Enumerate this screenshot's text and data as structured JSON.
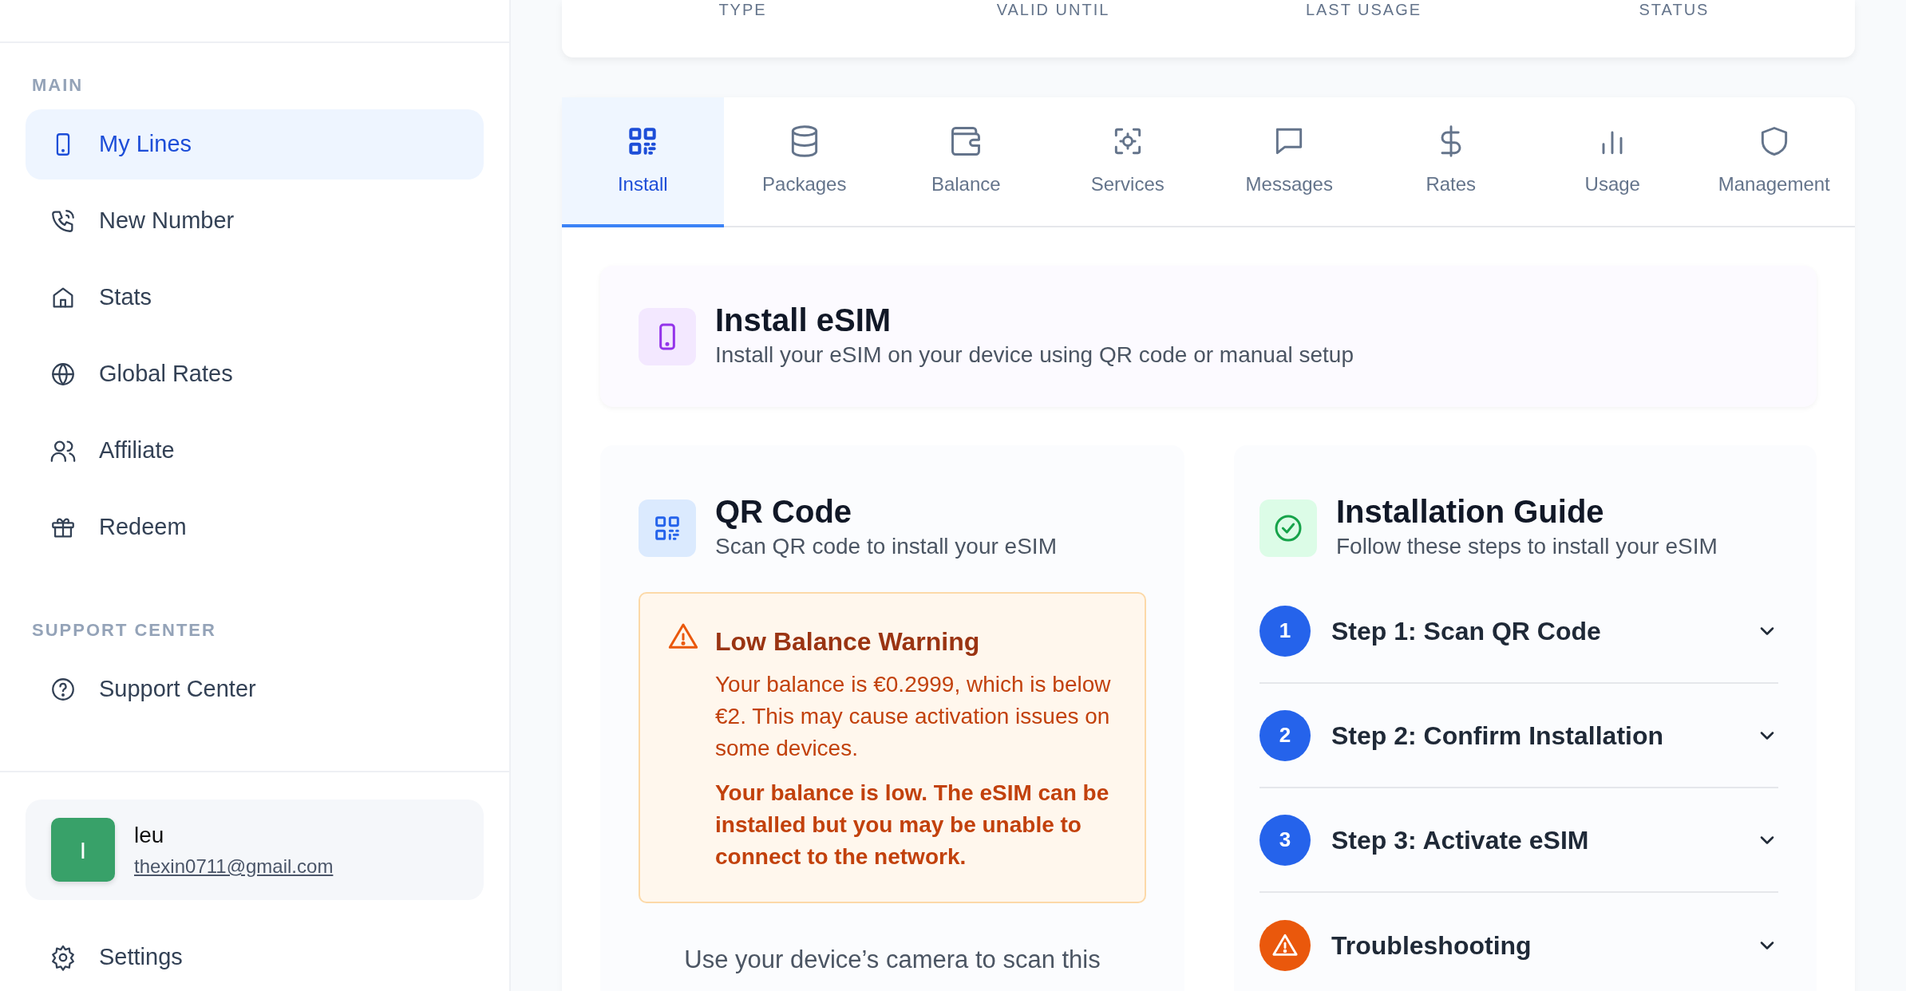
{
  "sidebar": {
    "sections": [
      {
        "label": "MAIN",
        "items": [
          {
            "label": "My Lines",
            "selected": true
          },
          {
            "label": "New Number",
            "selected": false
          },
          {
            "label": "Stats",
            "selected": false
          },
          {
            "label": "Global Rates",
            "selected": false
          },
          {
            "label": "Affiliate",
            "selected": false
          },
          {
            "label": "Redeem",
            "selected": false
          }
        ]
      },
      {
        "label": "SUPPORT CENTER",
        "items": [
          {
            "label": "Support Center",
            "selected": false
          }
        ]
      }
    ],
    "user": {
      "avatar": "I",
      "name": "leu",
      "email": "thexin0711@gmail.com"
    },
    "settings": "Settings"
  },
  "lines_table": {
    "columns": [
      "TYPE",
      "VALID UNTIL",
      "LAST USAGE",
      "STATUS"
    ]
  },
  "tabs": [
    {
      "label": "Install",
      "selected": true
    },
    {
      "label": "Packages",
      "selected": false
    },
    {
      "label": "Balance",
      "selected": false
    },
    {
      "label": "Services",
      "selected": false
    },
    {
      "label": "Messages",
      "selected": false
    },
    {
      "label": "Rates",
      "selected": false
    },
    {
      "label": "Usage",
      "selected": false
    },
    {
      "label": "Management",
      "selected": false
    }
  ],
  "header": {
    "title": "Install eSIM",
    "subtitle": "Install your eSIM on your device using QR code or manual setup"
  },
  "qr_card": {
    "title": "QR Code",
    "subtitle": "Scan QR code to install your eSIM",
    "warning": {
      "title": "Low Balance Warning",
      "text": "Your balance is €0.2999, which is below €2. This may cause activation issues on some devices.",
      "emphasis": "Your balance is low. The eSIM can be installed but you may be unable to connect to the network."
    },
    "instructions": "Use your device’s camera to scan this"
  },
  "guide": {
    "title": "Installation Guide",
    "subtitle": "Follow these steps to install your eSIM",
    "steps": [
      {
        "kind": "number",
        "badge": "1",
        "title": "Step 1: Scan QR Code",
        "expanded": false
      },
      {
        "kind": "number",
        "badge": "2",
        "title": "Step 2: Confirm Installation",
        "expanded": false
      },
      {
        "kind": "number",
        "badge": "3",
        "title": "Step 3: Activate eSIM",
        "expanded": false
      },
      {
        "kind": "warning",
        "title": "Troubleshooting",
        "expanded": false
      }
    ]
  }
}
